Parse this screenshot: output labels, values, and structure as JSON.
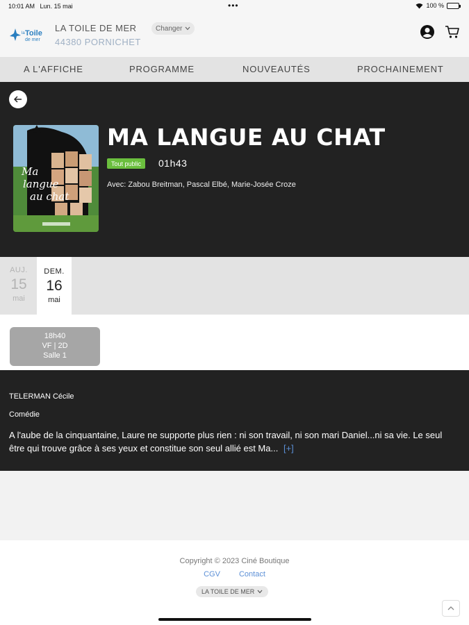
{
  "status": {
    "time": "10:01 AM",
    "date": "Lun. 15 mai",
    "battery": "100 %",
    "battery_level": 1.0
  },
  "header": {
    "logo_text": "la Toile de mer",
    "cinema_name": "LA TOILE DE MER",
    "cinema_city": "44380 PORNICHET",
    "change_label": "Changer"
  },
  "nav": {
    "tabs": [
      "A L'AFFICHE",
      "PROGRAMME",
      "NOUVEAUTÉS",
      "PROCHAINEMENT"
    ]
  },
  "movie": {
    "title": "MA LANGUE AU CHAT",
    "rating": "Tout public",
    "duration": "01h43",
    "cast": "Avec: Zabou Breitman, Pascal Elbé, Marie-Josée Croze",
    "poster_title": "Ma langue au chat"
  },
  "dates": [
    {
      "dow": "AUJ.",
      "day": "15",
      "month": "mai",
      "state": "past"
    },
    {
      "dow": "DEM.",
      "day": "16",
      "month": "mai",
      "state": "active"
    }
  ],
  "session": {
    "time": "18h40",
    "version": "VF | 2D",
    "room": "Salle 1"
  },
  "details": {
    "director": "TELERMAN Cécile",
    "genre": "Comédie",
    "synopsis": "A l'aube de la cinquantaine, Laure ne supporte plus rien : ni son travail, ni son mari Daniel...ni sa vie. Le seul être qui trouve grâce à ses yeux et constitue son seul allié est Ma...",
    "more_label": "[+]"
  },
  "footer": {
    "copyright": "Copyright © 2023 Ciné Boutique",
    "cgv": "CGV",
    "contact": "Contact",
    "cinema_select": "LA TOILE DE MER"
  },
  "colors": {
    "dark_bg": "#222222",
    "badge_green": "#6bbf3e",
    "link_blue": "#5b8fd6"
  }
}
